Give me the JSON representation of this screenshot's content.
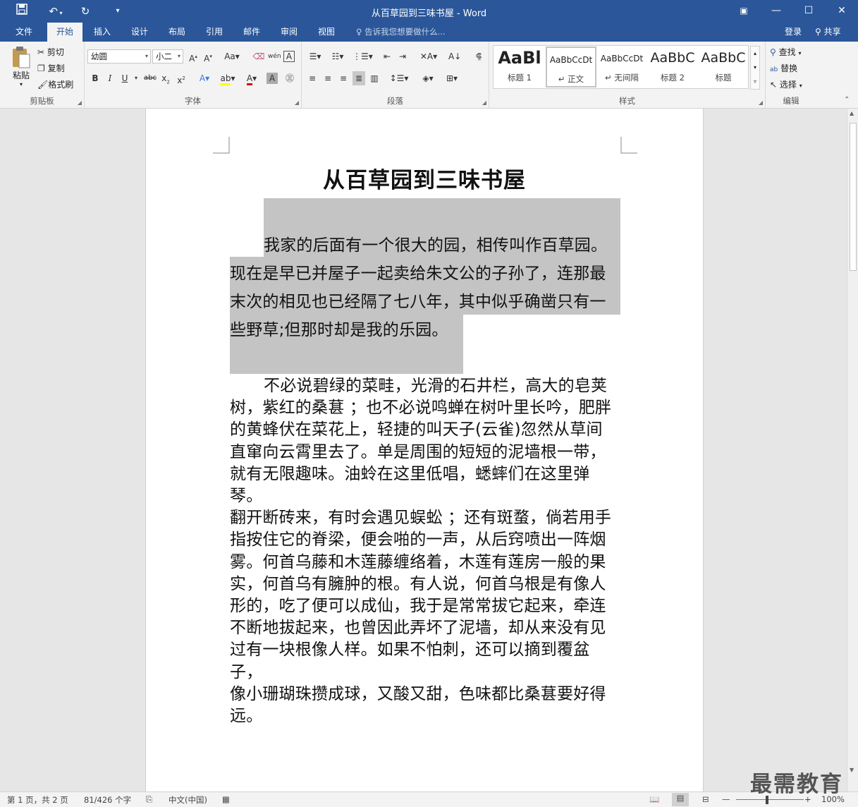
{
  "window": {
    "title": "从百草园到三味书屋 - Word",
    "controls": {
      "ribbon_display": "▣",
      "minimize": "—",
      "maximize": "☐",
      "close": "✕"
    }
  },
  "quick_access": {
    "save_icon": "save-icon",
    "undo_icon": "undo-icon",
    "redo_icon": "redo-icon",
    "customize_icon": "customize-icon"
  },
  "tabs": [
    "文件",
    "开始",
    "插入",
    "设计",
    "布局",
    "引用",
    "邮件",
    "审阅",
    "视图"
  ],
  "active_tab": "开始",
  "tell_me": "告诉我您想要做什么...",
  "account": {
    "login": "登录",
    "share": "共享"
  },
  "ribbon": {
    "clipboard": {
      "paste": "粘贴",
      "cut": "剪切",
      "copy": "复制",
      "format_painter": "格式刷",
      "label": "剪贴板"
    },
    "font": {
      "name": "幼圆",
      "size": "小二",
      "label": "字体"
    },
    "paragraph": {
      "label": "段落"
    },
    "styles": {
      "items": [
        {
          "sample": "AaBl",
          "name": "标题 1"
        },
        {
          "sample": "AaBbCcDt",
          "name": "↵ 正文"
        },
        {
          "sample": "AaBbCcDt",
          "name": "↵ 无间隔"
        },
        {
          "sample": "AaBbC",
          "name": "标题 2"
        },
        {
          "sample": "AaBbC",
          "name": "标题"
        }
      ],
      "label": "样式"
    },
    "editing": {
      "find": "查找",
      "replace": "替换",
      "select": "选择",
      "label": "编辑"
    }
  },
  "document": {
    "title": "从百草园到三味书屋",
    "para1": {
      "line1": "我家的后面有一个很大的园，相传叫作百草园。",
      "line2": "现在是早已并屋子一起卖给朱文公的子孙了，连那最",
      "line3": "末次的相见也已经隔了七八年，其中似乎确凿只有一",
      "line4": "些野草;但那时却是我的乐园。"
    },
    "para2": [
      "不必说碧绿的菜畦，光滑的石井栏，高大的皂荚",
      "树，紫红的桑葚 ；也不必说鸣蝉在树叶里长吟，肥胖",
      "的黄蜂伏在菜花上，轻捷的叫天子(云雀)忽然从草间",
      "直窜向云霄里去了。单是周围的短短的泥墙根一带，",
      "就有无限趣味。油蛉在这里低唱，蟋蟀们在这里弹琴。",
      "翻开断砖来，有时会遇见蜈蚣 ；还有斑蝥，倘若用手",
      "指按住它的脊梁，便会啪的一声，从后窍喷出一阵烟",
      "雾。何首乌藤和木莲藤缠络着，木莲有莲房一般的果",
      "实，何首乌有臃肿的根。有人说，何首乌根是有像人",
      "形的，吃了便可以成仙，我于是常常拔它起来，牵连",
      "不断地拔起来，也曾因此弄坏了泥墙，却从来没有见",
      "过有一块根像人样。如果不怕刺，还可以摘到覆盆子，",
      "像小珊瑚珠攒成球，又酸又甜，色味都比桑葚要好得",
      "远。"
    ]
  },
  "status": {
    "page": "第 1 页，共 2 页",
    "words": "81/426 个字",
    "language": "中文(中国)",
    "zoom": "100%"
  },
  "watermark": "最需教育",
  "colors": {
    "accent": "#2b579a",
    "selection": "#c4c4c4"
  }
}
